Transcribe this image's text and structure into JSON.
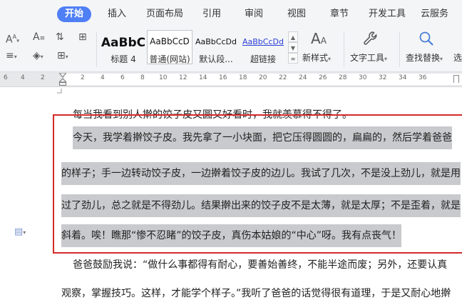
{
  "tabs": [
    {
      "label": "开始",
      "active": true
    },
    {
      "label": "插入"
    },
    {
      "label": "页面布局"
    },
    {
      "label": "引用"
    },
    {
      "label": "审阅"
    },
    {
      "label": "视图"
    },
    {
      "label": "章节"
    },
    {
      "label": "开发工具"
    },
    {
      "label": "云服务"
    }
  ],
  "ribbon": {
    "styles": [
      {
        "sample": "AaBbC",
        "label": "标题 4"
      },
      {
        "sample": "AaBbCcD",
        "label": "普通(网站)",
        "selected": true
      },
      {
        "sample": "AaBbCcDd",
        "label": "默认段..."
      },
      {
        "sample": "AaBbCcDd",
        "label": "超链接"
      }
    ],
    "new_style_label": "新样式",
    "text_tools_label": "文字工具",
    "find_replace_label": "查找替换",
    "select_label": "选"
  },
  "ruler": {
    "left_numbers": [
      "6",
      "4",
      "2"
    ],
    "right_numbers": [
      "2",
      "4",
      "6",
      "8",
      "10",
      "12",
      "14",
      "16",
      "18",
      "20",
      "22",
      "24",
      "26",
      "28",
      "30",
      "32",
      "34",
      "36"
    ]
  },
  "document": {
    "lines": [
      "每当我看到别人擀的饺子皮又圆又好看时，我就羡慕得不得了。",
      "今天，我学着擀饺子皮。我先拿了一小块面，把它压得圆圆的，扁扁的，然后学着爸爸",
      "的样子；手一边转动饺子皮，一边擀着饺子皮的边儿。我试了几次，不是没上劲儿，就是用",
      "过了劲儿，总之就是不得劲儿。结果擀出来的饺子皮不是太薄，就是太厚；不是歪着，就是",
      "斜着。唉！瞧那“惨不忍睹”的饺子皮，真伤本姑娘的“中心”呀。我有点丧气！",
      "爸爸鼓励我说：“做什么事都得有耐心，要善始善终，不能半途而废；另外，还要认真",
      "观察，掌握技巧。这样，才能学个样子。”我听了爸爸的话觉得很有道理，于是又耐心地擀"
    ]
  },
  "colors": {
    "active_tab": "#4f7ff5",
    "selection": "#c9cacd",
    "red_box": "#d42a2a"
  },
  "icons": [
    "font-size-icon",
    "paragraph-shading-icon",
    "fill-color-icon",
    "border-icon",
    "sort-icon",
    "table-grid-icon",
    "new-style-icon",
    "wrench-icon",
    "search-icon",
    "document-icon",
    "indent-marker-icon"
  ]
}
